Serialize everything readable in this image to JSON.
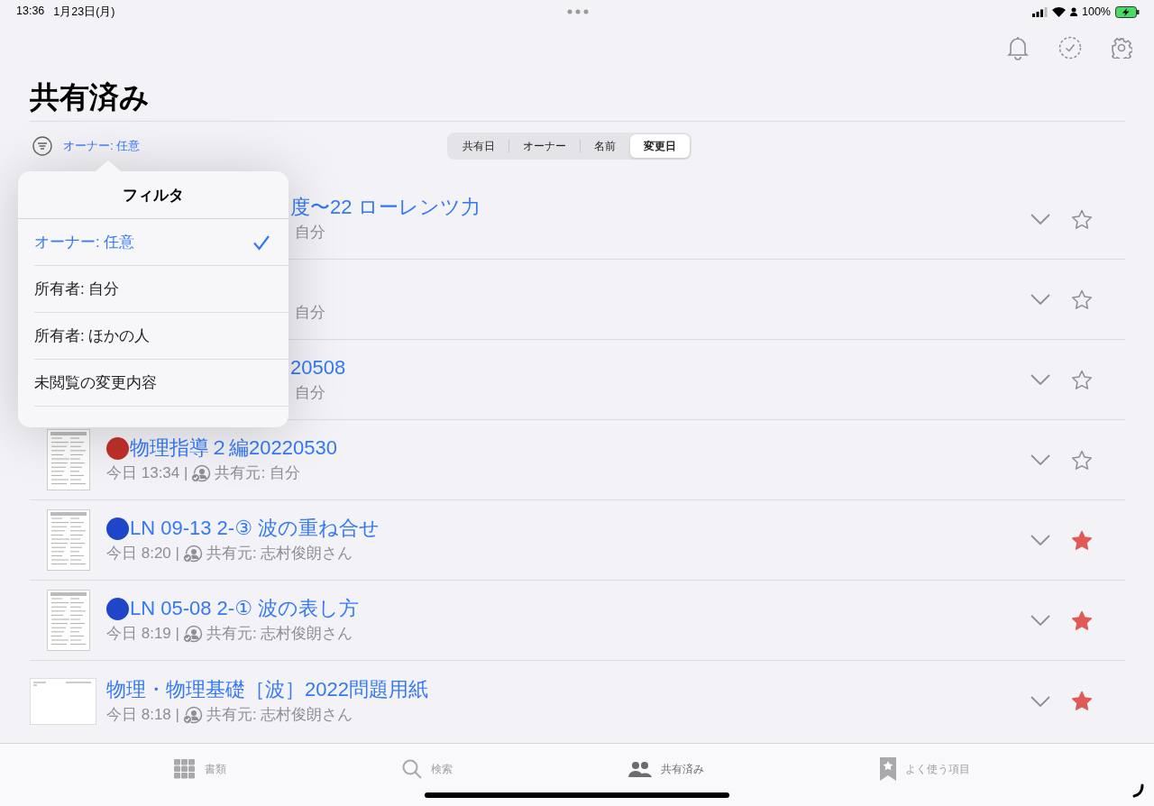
{
  "status_bar": {
    "time": "13:36",
    "date": "1月23日(月)",
    "battery": "100%"
  },
  "page": {
    "title": "共有済み"
  },
  "filter": {
    "label": "オーナー: 任意"
  },
  "sort": [
    {
      "label": "共有日",
      "selected": false
    },
    {
      "label": "オーナー",
      "selected": false
    },
    {
      "label": "名前",
      "selected": false
    },
    {
      "label": "変更日",
      "selected": true
    }
  ],
  "documents": [
    {
      "kind": "covered",
      "title": "度〜22 ローレンツ力",
      "shared_by": "自分",
      "starred": false
    },
    {
      "kind": "covered",
      "shared_by": "自分",
      "starred": false
    },
    {
      "kind": "covered",
      "title": "20508",
      "shared_by": "自分",
      "starred": false
    },
    {
      "kind": "portrait",
      "color": "#c0302a",
      "title": "物理指導２編20220530",
      "time": "今日 13:34 |",
      "shared_by": "共有元: 自分",
      "starred": false
    },
    {
      "kind": "portrait",
      "color": "#1f45c8",
      "title": "LN 09-13 2-③ 波の重ね合せ",
      "time": "今日 8:20 |",
      "shared_by": "共有元: 志村俊朗さん",
      "starred": true
    },
    {
      "kind": "portrait",
      "color": "#1f45c8",
      "title": "LN 05-08 2-① 波の表し方",
      "time": "今日 8:19 |",
      "shared_by": "共有元: 志村俊朗さん",
      "starred": true
    },
    {
      "kind": "landscape",
      "title": "物理・物理基礎［波］2022問題用紙",
      "time": "今日 8:18 |",
      "shared_by": "共有元: 志村俊朗さん",
      "starred": true
    }
  ],
  "filter_menu": {
    "title": "フィルタ",
    "options": [
      {
        "label": "オーナー: 任意",
        "selected": true
      },
      {
        "label": "所有者: 自分",
        "selected": false
      },
      {
        "label": "所有者: ほかの人",
        "selected": false
      },
      {
        "label": "未閲覧の変更内容",
        "selected": false
      }
    ]
  },
  "tab_bar": [
    {
      "kind": "documents",
      "label": "書類",
      "selected": false
    },
    {
      "kind": "search",
      "label": "検索",
      "selected": false
    },
    {
      "kind": "shared",
      "label": "共有済み",
      "selected": true
    },
    {
      "kind": "favorites",
      "label": "よく使う項目",
      "selected": false
    }
  ]
}
